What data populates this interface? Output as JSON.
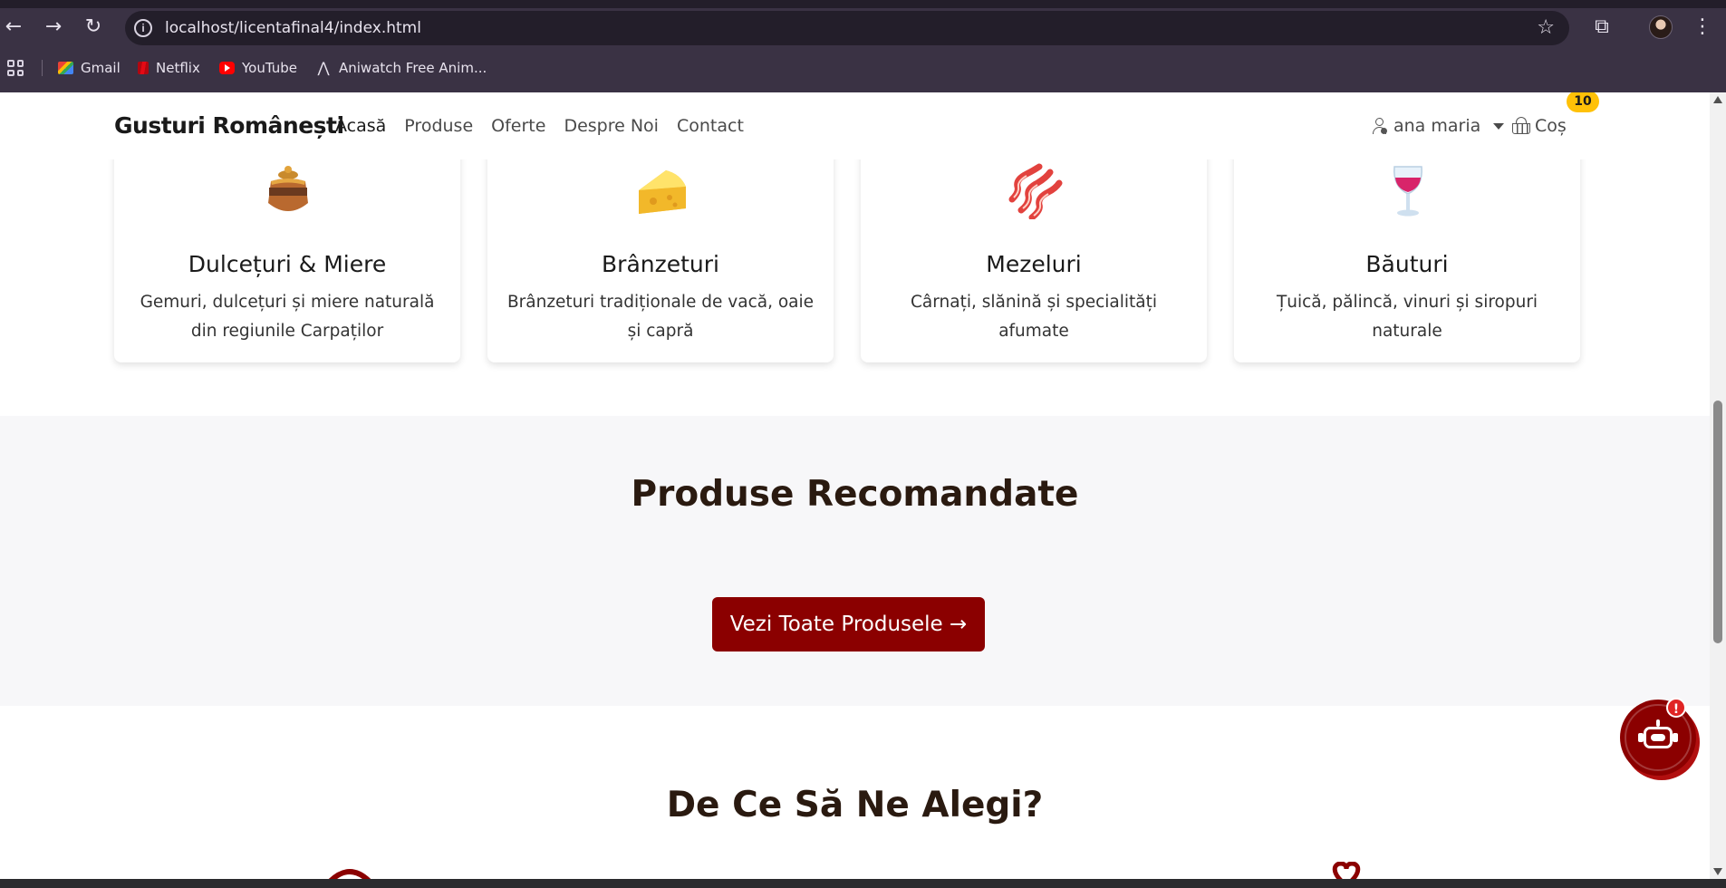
{
  "browser": {
    "url": "localhost/licentafinal4/index.html",
    "bookmarks": [
      {
        "label": "Gmail",
        "icon": "gmail-icon"
      },
      {
        "label": "Netflix",
        "icon": "netflix-icon"
      },
      {
        "label": "YouTube",
        "icon": "youtube-icon"
      },
      {
        "label": "Aniwatch Free Anim...",
        "icon": "aniwatch-icon"
      }
    ]
  },
  "navbar": {
    "brand": "Gusturi Românești",
    "links": [
      "Acasă",
      "Produse",
      "Oferte",
      "Despre Noi",
      "Contact"
    ],
    "active_link": "Acasă",
    "user": "ana maria",
    "cart_label": "Coș",
    "cart_count": "10"
  },
  "categories": [
    {
      "icon": "honey-pot-icon",
      "title": "Dulcețuri & Miere",
      "desc": "Gemuri, dulcețuri și miere naturală din regiunile Carpaților"
    },
    {
      "icon": "cheese-icon",
      "title": "Brânzeturi",
      "desc": "Brânzeturi tradiționale de vacă, oaie și capră"
    },
    {
      "icon": "bacon-icon",
      "title": "Mezeluri",
      "desc": "Cârnați, slănină și specialități afumate"
    },
    {
      "icon": "wine-glass-icon",
      "title": "Băuturi",
      "desc": "Țuică, pălincă, vinuri și siropuri naturale"
    }
  ],
  "recommended": {
    "title": "Produse Recomandate",
    "cta": "Vezi Toate Produsele →"
  },
  "why": {
    "title": "De Ce Să Ne Alegi?"
  },
  "chatbot": {
    "alert": "!"
  },
  "colors": {
    "accent": "#8b0000",
    "badge": "#ffc107",
    "section_bg": "#f7f7f9",
    "chrome": "#3a3244"
  }
}
